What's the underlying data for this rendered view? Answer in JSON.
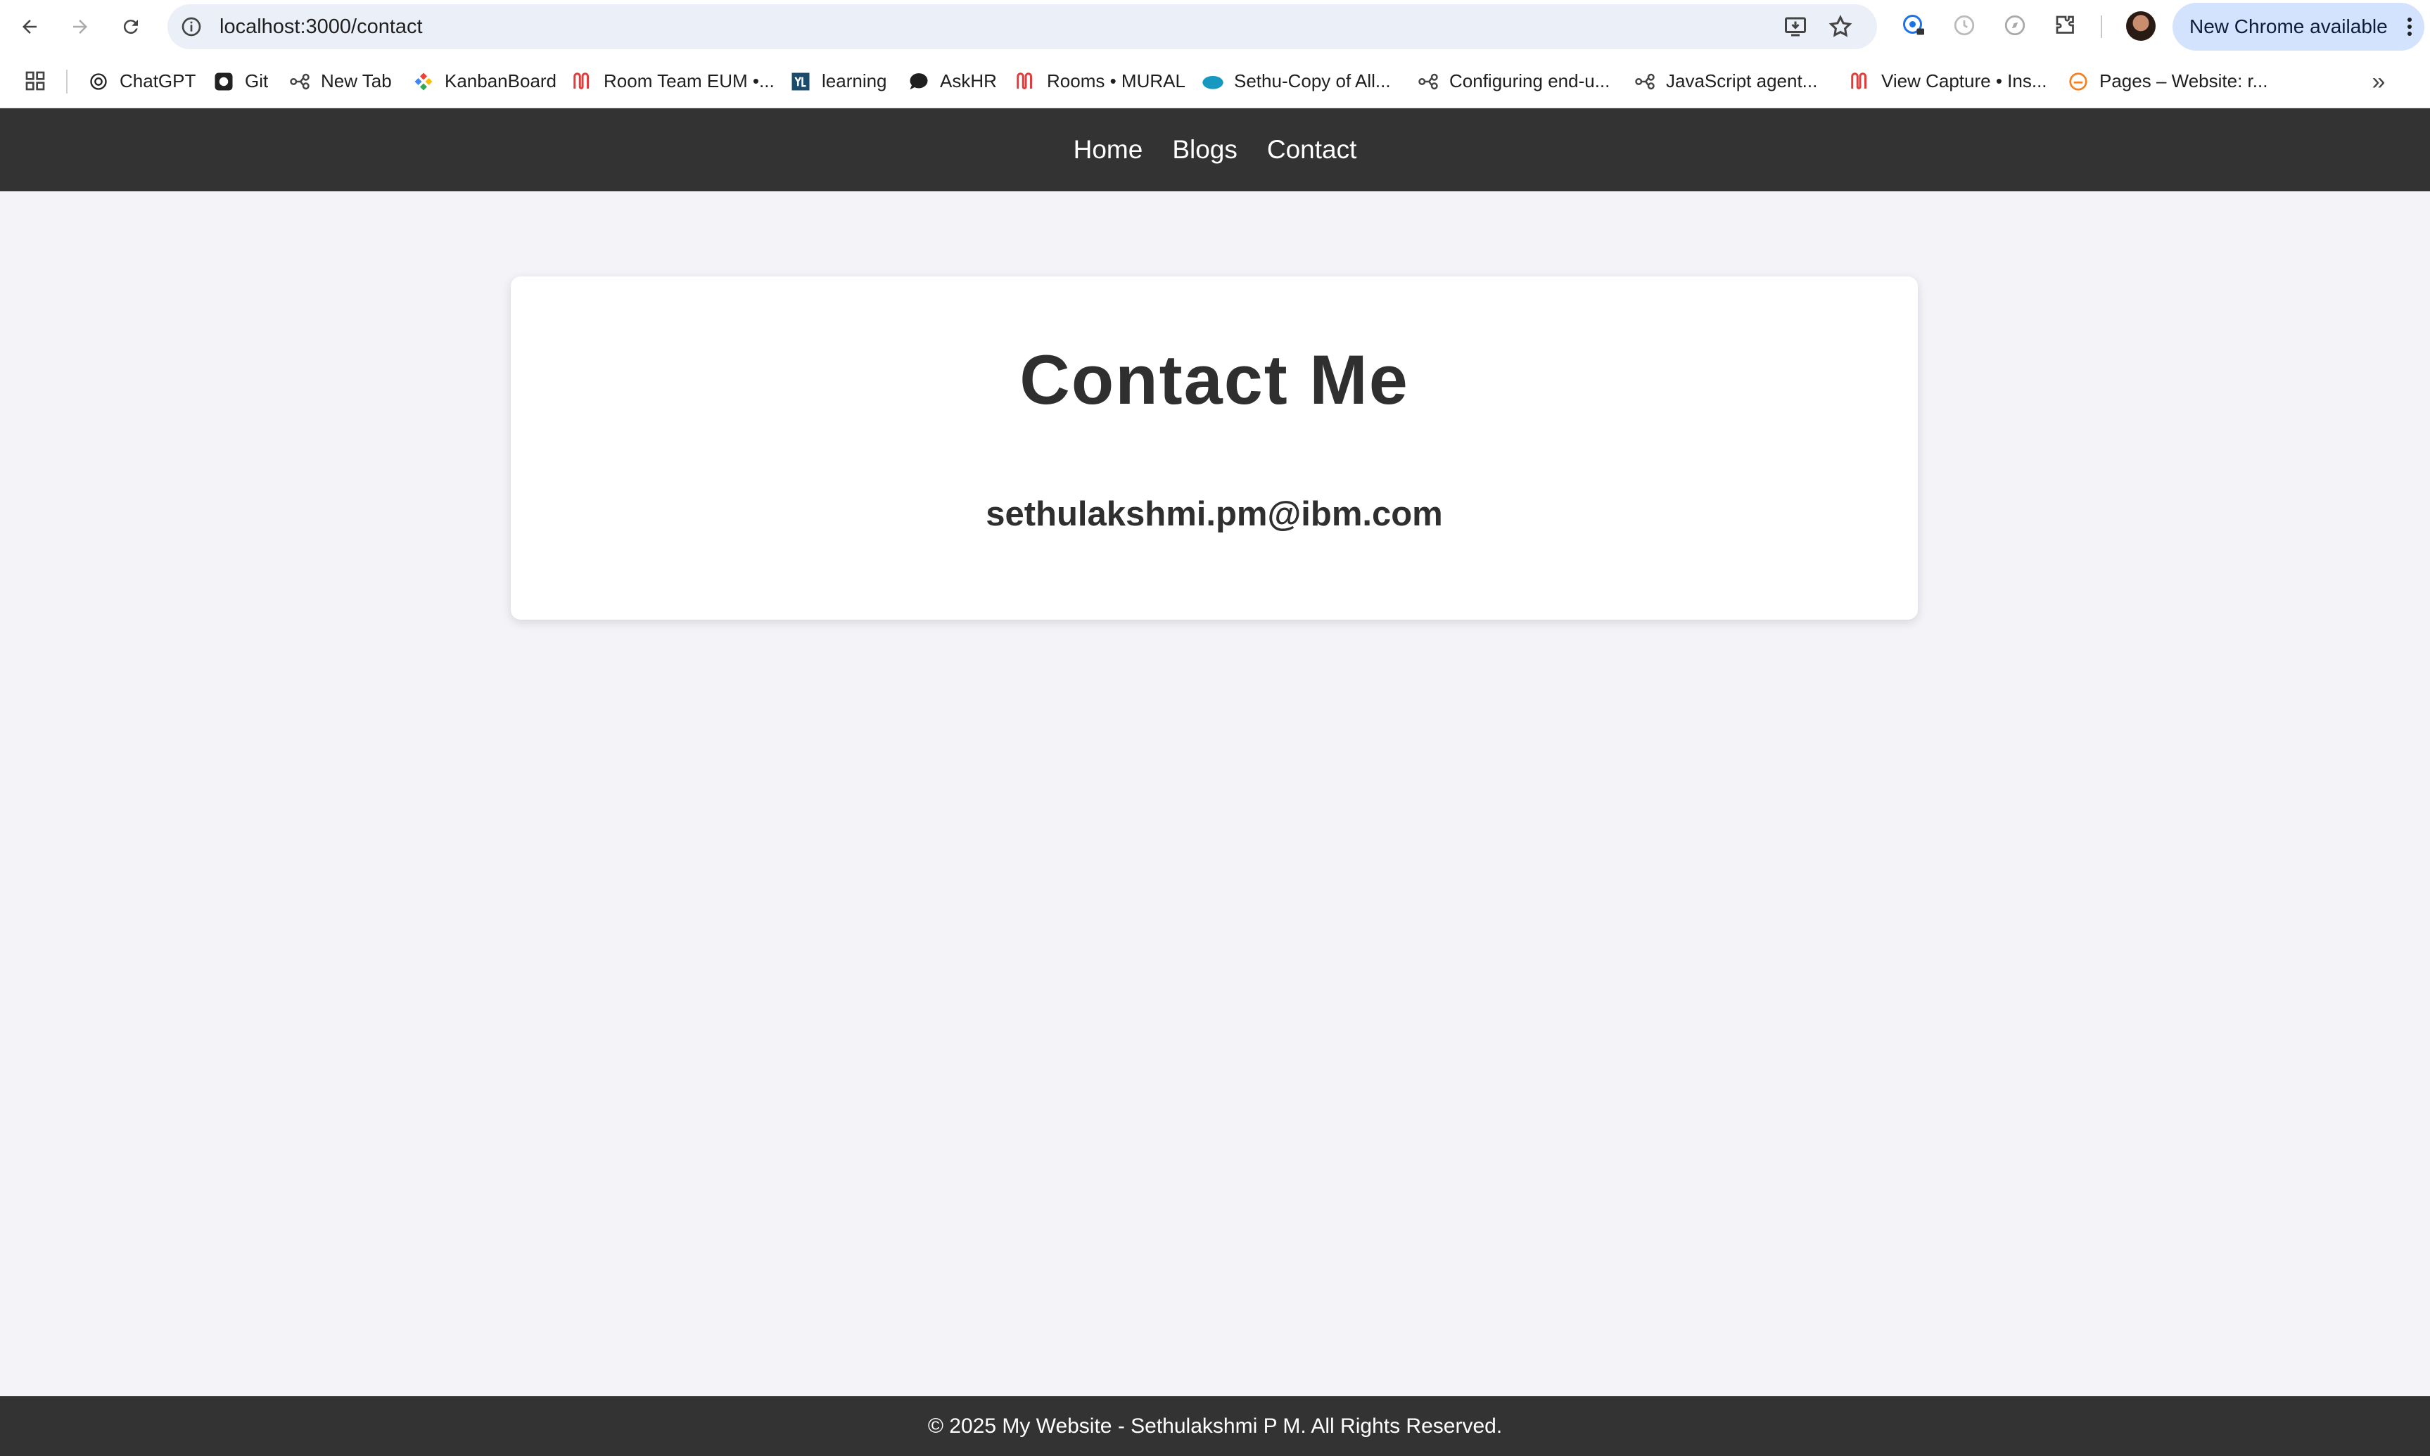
{
  "browser": {
    "url": "localhost:3000/contact",
    "update_label": "New Chrome available",
    "bookmarks": [
      {
        "label": "ChatGPT",
        "icon": "chatgpt-icon"
      },
      {
        "label": "Git",
        "icon": "github-icon"
      },
      {
        "label": "New Tab",
        "icon": "network-icon"
      },
      {
        "label": "KanbanBoard",
        "icon": "kanban-icon"
      },
      {
        "label": "Room Team EUM •...",
        "icon": "mural-icon"
      },
      {
        "label": "learning",
        "icon": "learning-icon"
      },
      {
        "label": "AskHR",
        "icon": "chat-bubble-icon"
      },
      {
        "label": "Rooms • MURAL",
        "icon": "mural-icon"
      },
      {
        "label": "Sethu-Copy of All...",
        "icon": "salesforce-icon"
      },
      {
        "label": "Configuring end-u...",
        "icon": "network-icon"
      },
      {
        "label": "JavaScript agent...",
        "icon": "network-icon"
      },
      {
        "label": "View Capture • Ins...",
        "icon": "mural-icon"
      },
      {
        "label": "Pages – Website: r...",
        "icon": "pages-icon"
      }
    ]
  },
  "site": {
    "nav": [
      {
        "label": "Home"
      },
      {
        "label": "Blogs"
      },
      {
        "label": "Contact"
      }
    ],
    "card": {
      "title": "Contact Me",
      "email": "sethulakshmi.pm@ibm.com"
    },
    "footer": "© 2025 My Website - Sethulakshmi P M. All Rights Reserved."
  },
  "colors": {
    "header_bg": "#333333",
    "page_bg": "#f3f3f8",
    "card_bg": "#ffffff",
    "text_dark": "#2f2f2f",
    "chrome_update_pill": "#d3e3fd"
  }
}
